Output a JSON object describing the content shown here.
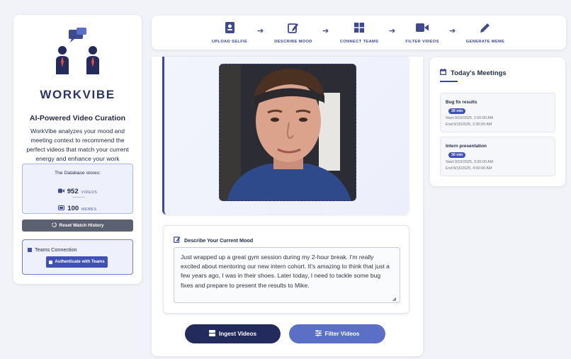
{
  "sidebar": {
    "brand": "WORKVIBE",
    "tagline": "AI-Powered Video Curation",
    "description": "WorkVibe analyzes your mood and meeting context to recommend the perfect videos that match your current energy and enhance your work experience.",
    "database": {
      "title": "The Database stores:",
      "videos_count": "952",
      "videos_label": "VIDEOS",
      "memes_count": "100",
      "memes_label": "MEMES"
    },
    "reset_label": "Reset Watch History",
    "teams": {
      "title": "Teams Connection",
      "auth_label": "Authenticate with Teams"
    }
  },
  "stepper": {
    "steps": [
      {
        "label": "UPLOAD SELFIE",
        "icon": "id-badge-icon"
      },
      {
        "label": "DESCRIBE MOOD",
        "icon": "edit-icon"
      },
      {
        "label": "CONNECT TEAMS",
        "icon": "grid-icon"
      },
      {
        "label": "FILTER VIDEOS",
        "icon": "video-camera-icon"
      },
      {
        "label": "GENERATE MEME",
        "icon": "pencil-icon"
      }
    ]
  },
  "main": {
    "mood_title": "Describe Your Current Mood",
    "mood_text": "Just wrapped up a great gym session during my 2-hour break. I'm really excited about mentoring our new intern cohort. It's amazing to think that just a few years ago, I was in their shoes. Later today, I need to tackle some bug fixes and prepare to present the results to Mike.",
    "ingest_label": "Ingest Videos",
    "filter_label": "Filter Videos"
  },
  "meetings": {
    "title": "Today's Meetings",
    "items": [
      {
        "name": "Bug fix results",
        "duration": "30 min",
        "start": "Start:9/15/2025, 2:00:00 AM",
        "end": "End:9/15/2025, 2:30:00 AM"
      },
      {
        "name": "Intern presentation",
        "duration": "30 min",
        "start": "Start:9/15/2025, 3:30:00 AM",
        "end": "End:9/15/2025, 4:00:00 AM"
      }
    ]
  },
  "colors": {
    "brand": "#2a3566",
    "accent": "#3f51b5",
    "dark_button": "#232a5c",
    "light_button": "#5b6fc6",
    "reset_button": "#5b6170"
  }
}
